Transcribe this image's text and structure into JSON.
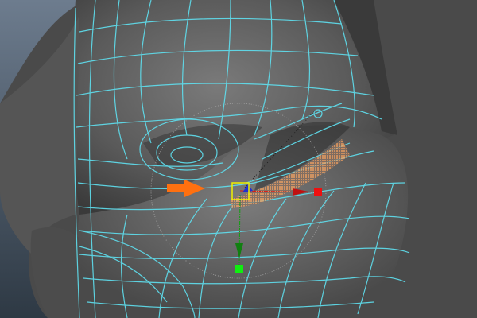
{
  "viewport": {
    "background_top": "#6b7a8c",
    "background_bottom": "#2f3a45",
    "mesh_color": "#5c5c5c",
    "wireframe_color": "#5fe0f0",
    "selection_color": "#f0a060",
    "arrow_color": "#ff7010"
  },
  "manipulator": {
    "x_axis_color": "#e01010",
    "y_axis_color": "#10c010",
    "z_axis_color": "#2030d0",
    "center_box_color": "#f0f000"
  }
}
